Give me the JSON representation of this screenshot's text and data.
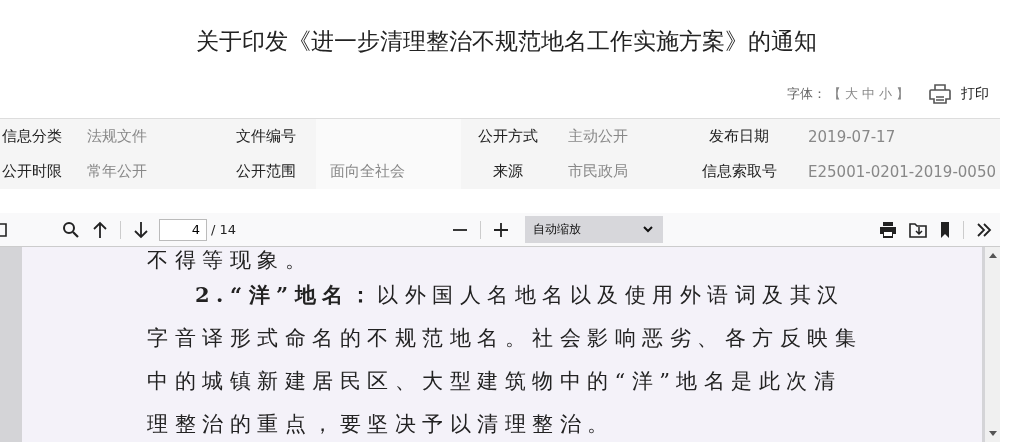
{
  "title": "关于印发《进一步清理整治不规范地名工作实施方案》的通知",
  "font_size": {
    "label": "字体：",
    "open": "【",
    "options": [
      "大",
      "中",
      "小"
    ],
    "close": "】"
  },
  "print": {
    "label": "打印"
  },
  "meta": [
    [
      {
        "label": "信息分类",
        "value": "法规文件"
      },
      {
        "label": "文件编号"
      },
      {
        "label": "公开方式",
        "value": "主动公开"
      },
      {
        "label": "发布日期",
        "value": "2019-07-17"
      }
    ],
    [
      {
        "label": "公开时限",
        "value": "常年公开"
      },
      {
        "label": "公开范围",
        "value": "面向全社会"
      },
      {
        "label": "来源",
        "value": "市民政局"
      },
      {
        "label": "信息索取号",
        "value": "E25001-0201-2019-0050"
      }
    ]
  ],
  "viewer": {
    "page": "4",
    "total": "/ 14",
    "zoom": "自动缩放",
    "lines": [
      {
        "text": "不得等现象。",
        "indent": false
      },
      {
        "text": "**2.“洋”地名：**以外国人名地名以及使用外语词及其汉字音译形式命名的不规范地名。社会影响恶劣、各方反映集中的城镇新建居民区、大型建筑物中的“洋”地名是此次清理整治的重点，要坚决予以清理整治。",
        "indent": true
      }
    ]
  }
}
